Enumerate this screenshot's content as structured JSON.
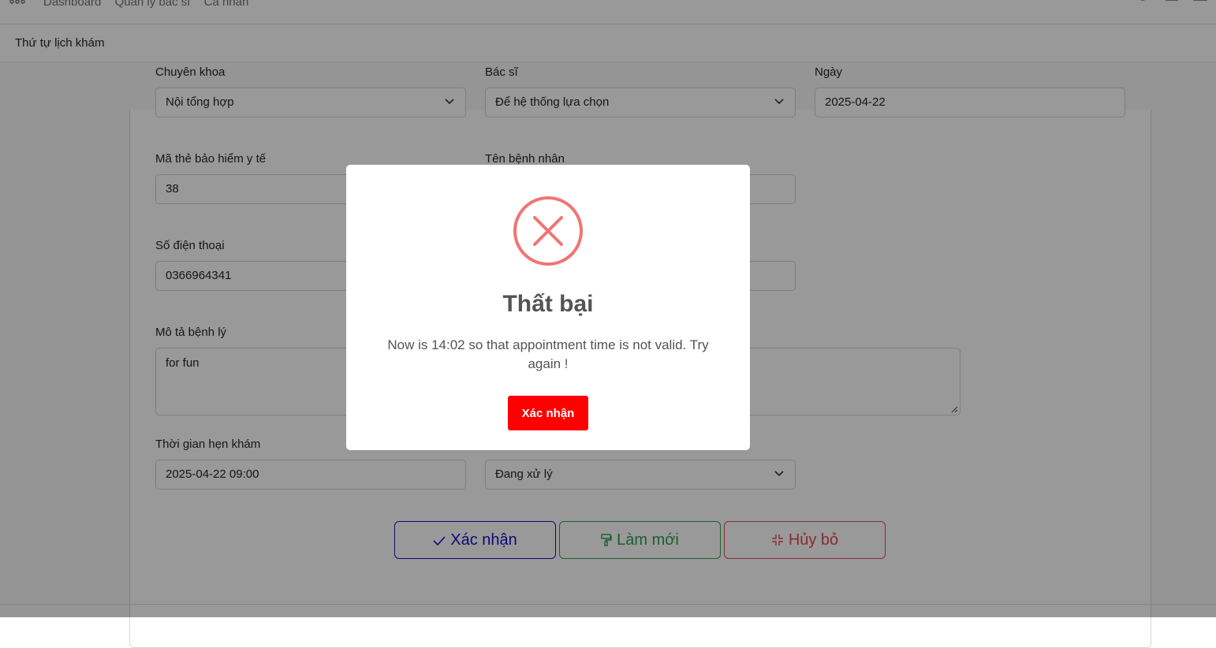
{
  "topbar": {
    "nav": [
      "Dashboard",
      "Quản lý bác sĩ",
      "Cá nhân"
    ]
  },
  "page_title": "Thứ tự lịch khám",
  "form": {
    "specialty_label": "Chuyên khoa",
    "specialty_value": "Nội tổng hợp",
    "doctor_label": "Bác sĩ",
    "doctor_value": "Để hệ thống lựa chọn",
    "date_label": "Ngày",
    "date_value": "2025-04-22",
    "insurance_label": "Mã thẻ bảo hiểm y tế",
    "insurance_value": "38",
    "patient_name_label": "Tên bệnh nhân",
    "phone_label": "Số điện thoại",
    "phone_value": "0366964341",
    "description_label": "Mô tả bệnh lý",
    "description_value": "for fun",
    "appointment_time_label": "Thời gian hẹn khám",
    "appointment_time_value": "2025-04-22 09:00",
    "status_value": "Đang xử lý"
  },
  "actions": {
    "confirm": "Xác nhận",
    "refresh": "Làm mới",
    "cancel": "Hủy bỏ"
  },
  "colors": {
    "confirm_outline": "#1a10c4",
    "refresh_outline": "#2e9e4f",
    "cancel_outline": "#e04b54",
    "error_icon": "#f27474",
    "modal_button": "#ff0000"
  },
  "modal": {
    "icon": "error-x-icon",
    "title": "Thất bại",
    "message": "Now is 14:02 so that appointment time is not valid. Try again !",
    "button": "Xác nhận"
  }
}
